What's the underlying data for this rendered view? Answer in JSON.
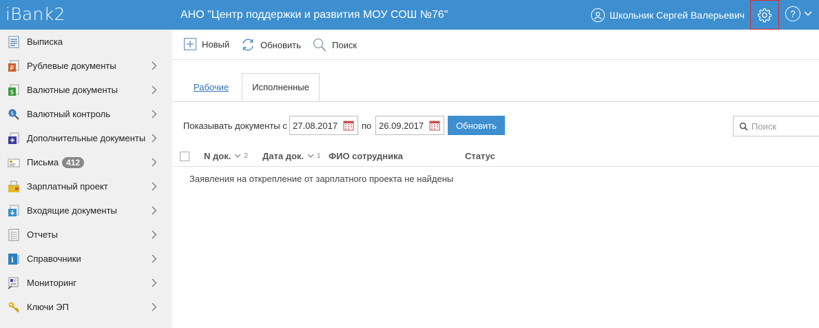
{
  "header": {
    "logo": "iBank2",
    "org": "АНО \"Центр поддержки и развития МОУ СОШ №76\"",
    "user": "Школьник Сергей Валерьевич",
    "help": "?"
  },
  "sidebar": {
    "items": [
      {
        "label": "Выписка",
        "icon": "statement-icon"
      },
      {
        "label": "Рублевые документы",
        "icon": "ruble-docs-icon"
      },
      {
        "label": "Валютные документы",
        "icon": "currency-docs-icon"
      },
      {
        "label": "Валютный контроль",
        "icon": "currency-control-icon"
      },
      {
        "label": "Дополнительные документы",
        "icon": "additional-docs-icon"
      },
      {
        "label": "Письма",
        "icon": "letter-icon",
        "badge": "412"
      },
      {
        "label": "Зарплатный проект",
        "icon": "salary-icon"
      },
      {
        "label": "Входящие документы",
        "icon": "incoming-docs-icon"
      },
      {
        "label": "Отчеты",
        "icon": "reports-icon"
      },
      {
        "label": "Справочники",
        "icon": "reference-icon"
      },
      {
        "label": "Мониторинг",
        "icon": "monitoring-icon"
      },
      {
        "label": "Ключи ЭП",
        "icon": "key-icon"
      }
    ]
  },
  "toolbar": {
    "new_label": "Новый",
    "refresh_label": "Обновить",
    "search_label": "Поиск"
  },
  "tabs": {
    "work": "Рабочие",
    "done": "Исполненные"
  },
  "filter": {
    "label": "Показывать документы с",
    "from": "27.08.2017",
    "to_label": "по",
    "to": "26.09.2017",
    "button": "Обновить",
    "search_placeholder": "Поиск"
  },
  "table": {
    "columns": [
      "N док.",
      "Дата док.",
      "ФИО сотрудника",
      "Статус"
    ],
    "sort_marks": [
      "2",
      "1"
    ],
    "empty_text": "Заявления на открепление от зарплатного проекта не найдены"
  },
  "colors": {
    "accent": "#3d8fcf",
    "highlight_border": "#e0262b"
  }
}
